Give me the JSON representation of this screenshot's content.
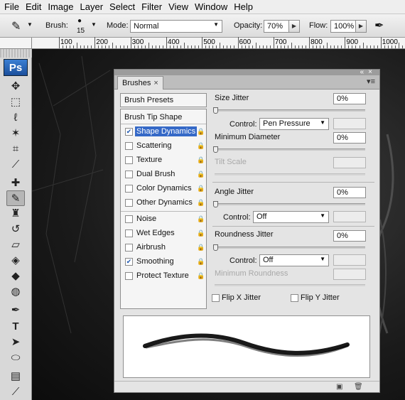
{
  "menu": [
    "File",
    "Edit",
    "Image",
    "Layer",
    "Select",
    "Filter",
    "View",
    "Window",
    "Help"
  ],
  "options": {
    "brush_label": "Brush:",
    "brush_size": "15",
    "mode_label": "Mode:",
    "mode_value": "Normal",
    "opacity_label": "Opacity:",
    "opacity_value": "70%",
    "flow_label": "Flow:",
    "flow_value": "100%"
  },
  "ruler": [
    "100",
    "200",
    "300",
    "400",
    "500",
    "600",
    "700",
    "800",
    "900",
    "1000"
  ],
  "toolbar": {
    "logo": "Ps"
  },
  "panel": {
    "tab": "Brushes",
    "brush_presets": "Brush Presets",
    "brush_tip_shape": "Brush Tip Shape",
    "items": [
      {
        "label": "Shape Dynamics",
        "checked": true,
        "selected": true
      },
      {
        "label": "Scattering",
        "checked": false
      },
      {
        "label": "Texture",
        "checked": false
      },
      {
        "label": "Dual Brush",
        "checked": false
      },
      {
        "label": "Color Dynamics",
        "checked": false
      },
      {
        "label": "Other Dynamics",
        "checked": false
      },
      {
        "label": "Noise",
        "checked": false
      },
      {
        "label": "Wet Edges",
        "checked": false
      },
      {
        "label": "Airbrush",
        "checked": false
      },
      {
        "label": "Smoothing",
        "checked": true
      },
      {
        "label": "Protect Texture",
        "checked": false
      }
    ],
    "settings": {
      "size_jitter": {
        "label": "Size Jitter",
        "value": "0%"
      },
      "control1": {
        "label": "Control:",
        "value": "Pen Pressure"
      },
      "min_diameter": {
        "label": "Minimum Diameter",
        "value": "0%"
      },
      "tilt_scale": {
        "label": "Tilt Scale"
      },
      "angle_jitter": {
        "label": "Angle Jitter",
        "value": "0%"
      },
      "control2": {
        "label": "Control:",
        "value": "Off"
      },
      "roundness_jitter": {
        "label": "Roundness Jitter",
        "value": "0%"
      },
      "control3": {
        "label": "Control:",
        "value": "Off"
      },
      "min_roundness": {
        "label": "Minimum Roundness"
      },
      "flip_x": {
        "label": "Flip X Jitter",
        "checked": false
      },
      "flip_y": {
        "label": "Flip Y Jitter",
        "checked": false
      }
    }
  }
}
